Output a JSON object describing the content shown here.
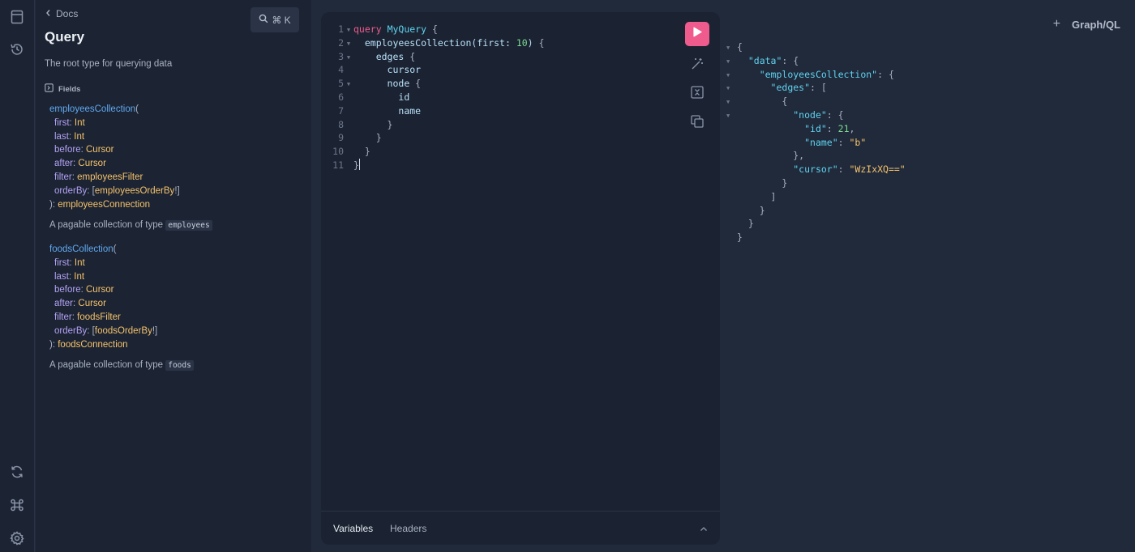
{
  "brand": {
    "logo_text": "Graph/QL",
    "add_tab_symbol": "+"
  },
  "rail": {
    "icons": [
      "docs-explorer-icon",
      "history-icon",
      "refetch-schema-icon",
      "shortcuts-icon",
      "settings-icon"
    ]
  },
  "docs": {
    "back_label": "Docs",
    "search_shortcut": "⌘ K",
    "title": "Query",
    "description": "The root type for querying data",
    "fields_header": "Fields",
    "fields": [
      {
        "name": "employeesCollection",
        "args": [
          {
            "name": "first",
            "type": "Int",
            "wrap": ""
          },
          {
            "name": "last",
            "type": "Int",
            "wrap": ""
          },
          {
            "name": "before",
            "type": "Cursor",
            "wrap": ""
          },
          {
            "name": "after",
            "type": "Cursor",
            "wrap": ""
          },
          {
            "name": "filter",
            "type": "employeesFilter",
            "wrap": ""
          },
          {
            "name": "orderBy",
            "type": "employeesOrderBy",
            "wrap": "list_nonnull"
          }
        ],
        "return_type": "employeesConnection",
        "description_prefix": "A pagable collection of type",
        "description_code": "employees"
      },
      {
        "name": "foodsCollection",
        "args": [
          {
            "name": "first",
            "type": "Int",
            "wrap": ""
          },
          {
            "name": "last",
            "type": "Int",
            "wrap": ""
          },
          {
            "name": "before",
            "type": "Cursor",
            "wrap": ""
          },
          {
            "name": "after",
            "type": "Cursor",
            "wrap": ""
          },
          {
            "name": "filter",
            "type": "foodsFilter",
            "wrap": ""
          },
          {
            "name": "orderBy",
            "type": "foodsOrderBy",
            "wrap": "list_nonnull"
          }
        ],
        "return_type": "foodsConnection",
        "description_prefix": "A pagable collection of type",
        "description_code": "foods"
      }
    ]
  },
  "editor": {
    "lines": [
      {
        "n": "1",
        "fold": true,
        "indent": 0,
        "tokens": [
          [
            "kw",
            "query"
          ],
          [
            "t",
            " "
          ],
          [
            "opname",
            "MyQuery"
          ],
          [
            "t",
            " "
          ],
          [
            "brace",
            "{"
          ]
        ]
      },
      {
        "n": "2",
        "fold": true,
        "indent": 1,
        "tokens": [
          [
            "t",
            "employeesCollection("
          ],
          [
            "t",
            "first: "
          ],
          [
            "num",
            "10"
          ],
          [
            "t",
            ") "
          ],
          [
            "brace",
            "{"
          ]
        ]
      },
      {
        "n": "3",
        "fold": true,
        "indent": 2,
        "tokens": [
          [
            "t",
            "edges "
          ],
          [
            "brace",
            "{"
          ]
        ]
      },
      {
        "n": "4",
        "fold": false,
        "indent": 3,
        "tokens": [
          [
            "t",
            "cursor"
          ]
        ]
      },
      {
        "n": "5",
        "fold": true,
        "indent": 3,
        "tokens": [
          [
            "t",
            "node "
          ],
          [
            "brace",
            "{"
          ]
        ]
      },
      {
        "n": "6",
        "fold": false,
        "indent": 4,
        "tokens": [
          [
            "t",
            "id"
          ]
        ]
      },
      {
        "n": "7",
        "fold": false,
        "indent": 4,
        "tokens": [
          [
            "t",
            "name"
          ]
        ]
      },
      {
        "n": "8",
        "fold": false,
        "indent": 3,
        "tokens": [
          [
            "brace",
            "}"
          ]
        ]
      },
      {
        "n": "9",
        "fold": false,
        "indent": 2,
        "tokens": [
          [
            "brace",
            "}"
          ]
        ]
      },
      {
        "n": "10",
        "fold": false,
        "indent": 1,
        "tokens": [
          [
            "brace",
            "}"
          ]
        ]
      },
      {
        "n": "11",
        "fold": false,
        "indent": 0,
        "tokens": [
          [
            "brace",
            "}"
          ]
        ],
        "cursor": true
      }
    ],
    "tools": [
      "run-icon",
      "prettify-icon",
      "merge-fragments-icon",
      "copy-query-icon"
    ],
    "bottom_tabs": {
      "variables": "Variables",
      "headers": "Headers"
    }
  },
  "response": {
    "lines": [
      {
        "fold": true,
        "indent": 0,
        "tokens": [
          [
            "p",
            "{"
          ]
        ]
      },
      {
        "fold": true,
        "indent": 1,
        "tokens": [
          [
            "k",
            "\"data\""
          ],
          [
            "p",
            ": {"
          ]
        ]
      },
      {
        "fold": true,
        "indent": 2,
        "tokens": [
          [
            "k",
            "\"employeesCollection\""
          ],
          [
            "p",
            ": {"
          ]
        ]
      },
      {
        "fold": true,
        "indent": 3,
        "tokens": [
          [
            "k",
            "\"edges\""
          ],
          [
            "p",
            ": ["
          ]
        ]
      },
      {
        "fold": true,
        "indent": 4,
        "tokens": [
          [
            "p",
            "{"
          ]
        ]
      },
      {
        "fold": true,
        "indent": 5,
        "tokens": [
          [
            "k",
            "\"node\""
          ],
          [
            "p",
            ": {"
          ]
        ]
      },
      {
        "fold": false,
        "indent": 6,
        "tokens": [
          [
            "k",
            "\"id\""
          ],
          [
            "p",
            ": "
          ],
          [
            "n",
            "21"
          ],
          [
            "p",
            ","
          ]
        ]
      },
      {
        "fold": false,
        "indent": 6,
        "tokens": [
          [
            "k",
            "\"name\""
          ],
          [
            "p",
            ": "
          ],
          [
            "s",
            "\"b\""
          ]
        ]
      },
      {
        "fold": false,
        "indent": 5,
        "tokens": [
          [
            "p",
            "},"
          ]
        ]
      },
      {
        "fold": false,
        "indent": 5,
        "tokens": [
          [
            "k",
            "\"cursor\""
          ],
          [
            "p",
            ": "
          ],
          [
            "s",
            "\"WzIxXQ==\""
          ]
        ]
      },
      {
        "fold": false,
        "indent": 4,
        "tokens": [
          [
            "p",
            "}"
          ]
        ]
      },
      {
        "fold": false,
        "indent": 3,
        "tokens": [
          [
            "p",
            "]"
          ]
        ]
      },
      {
        "fold": false,
        "indent": 2,
        "tokens": [
          [
            "p",
            "}"
          ]
        ]
      },
      {
        "fold": false,
        "indent": 1,
        "tokens": [
          [
            "p",
            "}"
          ]
        ]
      },
      {
        "fold": false,
        "indent": 0,
        "tokens": [
          [
            "p",
            "}"
          ]
        ]
      }
    ]
  }
}
